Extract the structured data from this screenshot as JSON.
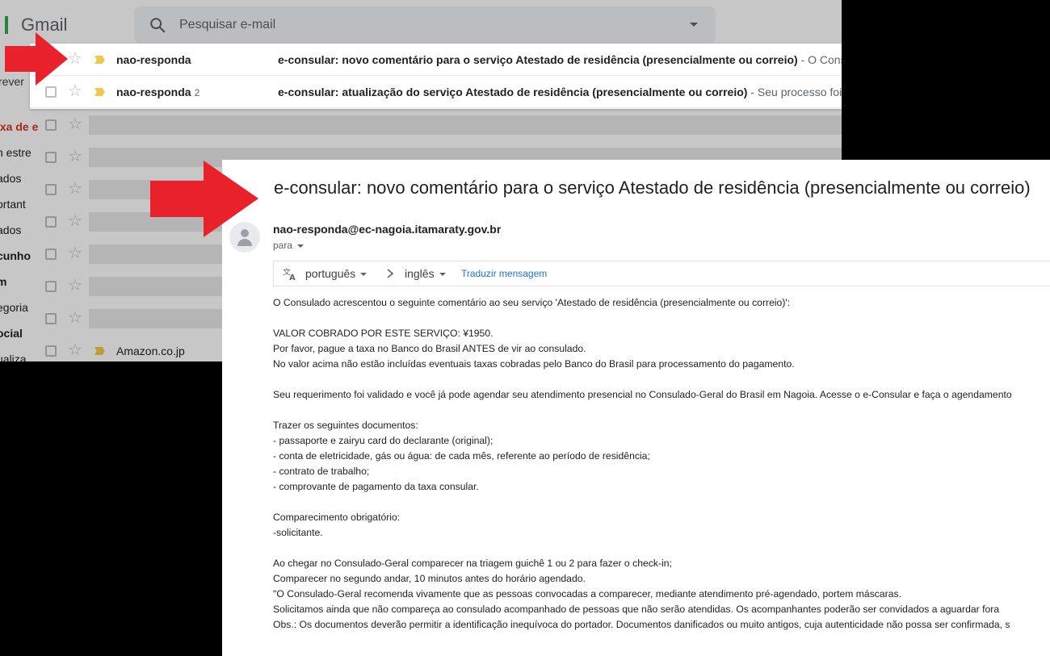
{
  "gmail": {
    "logo_text": "Gmail",
    "search_placeholder": "Pesquisar e-mail",
    "compose_label": "rever",
    "sidebar_items": [
      "ixa de e",
      "n estre",
      "ados",
      "ortant",
      "ados",
      "cunho",
      "m",
      "egoria",
      "ocial",
      "ualiza"
    ],
    "rows": [
      {
        "sender": "nao-responda",
        "count": "",
        "subject": "e-consular: novo comentário para o serviço Atestado de residência (presencialmente ou correio)",
        "snippet": " - O Consula"
      },
      {
        "sender": "nao-responda",
        "count": "2",
        "subject": "e-consular: atualização do serviço Atestado de residência (presencialmente ou correio)",
        "snippet": " - Seu processo foi re"
      }
    ],
    "faded_row_sender": "Amazon.co.jp"
  },
  "email": {
    "subject": "e-consular: novo comentário para o serviço Atestado de residência (presencialmente ou correio)",
    "sender_email": "nao-responda@ec-nagoia.itamaraty.gov.br",
    "recipient_label": "para",
    "translate": {
      "from_lang": "português",
      "to_lang": "inglês",
      "link": "Traduzir mensagem"
    },
    "body_lines": [
      "O Consulado acrescentou o seguinte comentário ao seu serviço 'Atestado de residência (presencialmente ou correio)':",
      "",
      "VALOR COBRADO POR ESTE SERVIÇO: ¥1950.",
      "Por favor, pague a taxa no Banco do Brasil ANTES de vir ao consulado.",
      "No valor acima não estão incluídas eventuais taxas cobradas pelo Banco do Brasil para processamento do pagamento.",
      "",
      "Seu requerimento foi validado e você já pode agendar seu atendimento presencial no Consulado-Geral do Brasil em Nagoia. Acesse o e-Consular e faça o agendamento",
      "",
      "Trazer os seguintes documentos:",
      "- passaporte e zairyu card do declarante (original);",
      "- conta de eletricidade, gás ou água: de cada mês, referente ao período de residência;",
      "- contrato de trabalho;",
      "- comprovante de pagamento da taxa consular.",
      "",
      "Comparecimento obrigatório:",
      "-solicitante.",
      "",
      "Ao chegar no Consulado-Geral comparecer na triagem guichê 1 ou 2 para fazer o check-in;",
      "Comparecer no segundo andar, 10 minutos antes do horário agendado.",
      "\"O Consulado-Geral recomenda vivamente que as pessoas convocadas a comparecer, mediante atendimento pré-agendado, portem máscaras.",
      "Solicitamos ainda que não compareça ao consulado acompanhado de pessoas que não serão atendidas. Os acompanhantes poderão ser convidados a aguardar fora",
      "Obs.: Os documentos deverão permitir a identificação inequívoca do portador. Documentos danificados ou muito antigos, cuja autenticidade não possa ser confirmada, s"
    ]
  },
  "colors": {
    "arrow_red": "#e8212a",
    "link_blue": "#1a73e8",
    "important_marker": "#f2c94c",
    "active_sidebar": "#d93025"
  }
}
